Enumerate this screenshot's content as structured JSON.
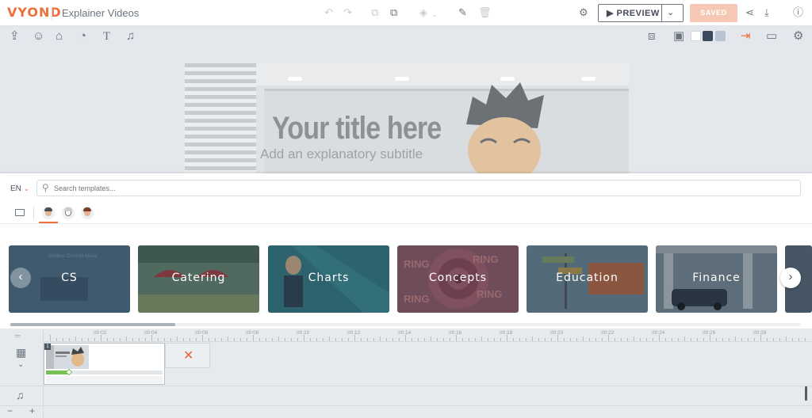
{
  "app": {
    "logo": "VYOND",
    "project_title": "Explainer Videos"
  },
  "topbar": {
    "preview_label": "▶ PREVIEW",
    "preview_chevron": "⌄",
    "saved_label": "SAVED",
    "icons": [
      "undo-icon",
      "redo-icon",
      "copy-icon",
      "paste-icon",
      "layers-icon",
      "brush-icon",
      "trash-icon",
      "settings-icon",
      "share-icon",
      "download-icon",
      "help-icon"
    ]
  },
  "toolbar2": {
    "icons": [
      "upload-icon",
      "character-icon",
      "prop-icon",
      "chart-icon",
      "text-icon",
      "music-icon",
      "swap-icon",
      "image-icon",
      "exit-icon",
      "camera-icon",
      "gear-icon"
    ],
    "swatches": [
      "#ffffff",
      "#3c4a5c",
      "#b8c4d2"
    ]
  },
  "stage": {
    "title": "Your title here",
    "subtitle": "Add an explanatory subtitle"
  },
  "panel": {
    "language": "EN",
    "search_placeholder": "Search templates...",
    "categories": [
      {
        "label": "CS",
        "color": "#4e6e86"
      },
      {
        "label": "Catering",
        "color": "#5f7f6e"
      },
      {
        "label": "Charts",
        "color": "#2f7e83"
      },
      {
        "label": "Concepts",
        "color": "#9a5a64"
      },
      {
        "label": "Education",
        "color": "#6e8a96"
      },
      {
        "label": "Finance",
        "color": "#7f8f98"
      }
    ]
  },
  "timeline": {
    "labels": [
      "00:02",
      "00:04",
      "00:06",
      "00:08",
      "00:10",
      "00:12",
      "00:14",
      "00:16",
      "00:18",
      "00:20",
      "00:22",
      "00:24",
      "00:26",
      "00:28"
    ],
    "scene_number": "1",
    "scene_progress": 0.2
  }
}
